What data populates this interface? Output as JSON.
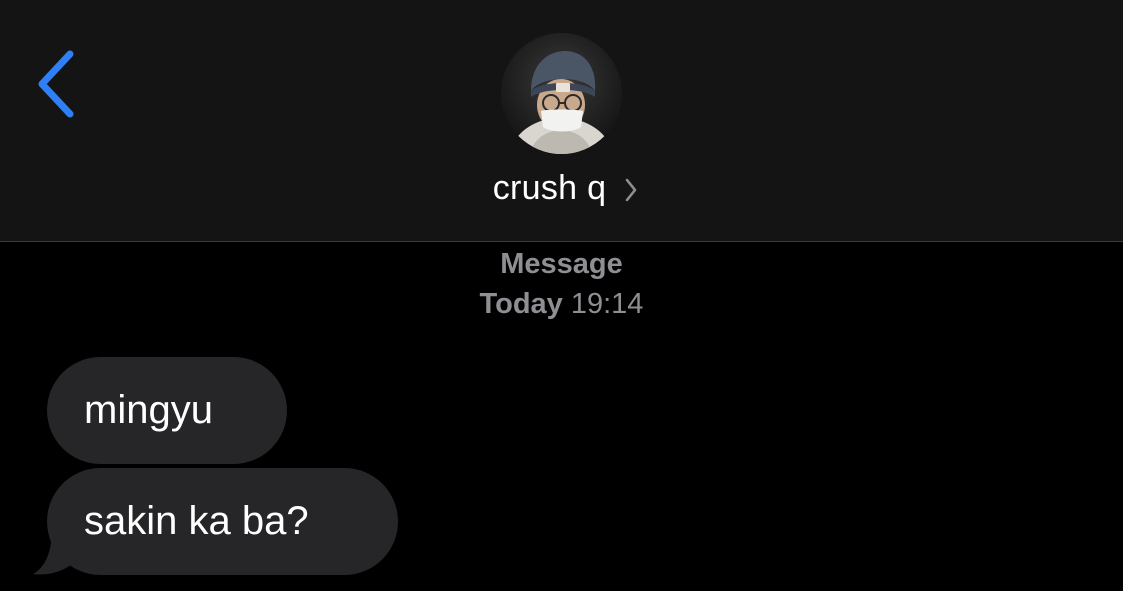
{
  "header": {
    "contact_name": "crush q",
    "back_icon": "chevron-left-icon",
    "details_icon": "chevron-right-icon",
    "avatar": "contact-photo"
  },
  "thread": {
    "service_label": "Message",
    "timestamp_day": "Today",
    "timestamp_time": "19:14"
  },
  "messages": [
    {
      "direction": "incoming",
      "text": "mingyu"
    },
    {
      "direction": "incoming",
      "text": "sakin ka ba?"
    }
  ],
  "colors": {
    "background": "#000000",
    "header_background": "#141414",
    "accent": "#2f80f6",
    "incoming_bubble": "#262628",
    "meta_text": "#8e8e93"
  }
}
